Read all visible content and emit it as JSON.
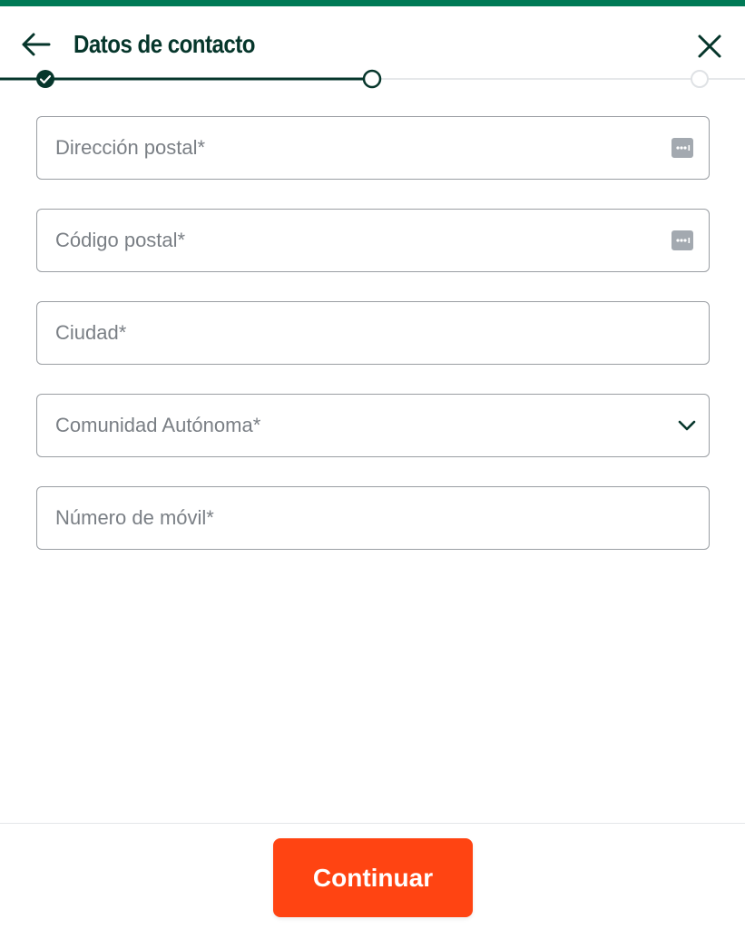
{
  "header": {
    "title": "Datos de contacto",
    "back_icon": "arrow-left-icon",
    "close_icon": "close-icon"
  },
  "stepper": {
    "total_steps": 3,
    "completed_steps": 1,
    "current_step": 2,
    "steps": [
      {
        "state": "completed",
        "icon": "check-icon"
      },
      {
        "state": "current",
        "icon": "circle-outline-icon"
      },
      {
        "state": "upcoming",
        "icon": "circle-outline-icon"
      }
    ]
  },
  "form": {
    "address": {
      "placeholder": "Dirección postal*",
      "value": "",
      "trailing_icon": "password-manager-icon"
    },
    "postal_code": {
      "placeholder": "Código postal*",
      "value": "",
      "trailing_icon": "password-manager-icon"
    },
    "city": {
      "placeholder": "Ciudad*",
      "value": ""
    },
    "region": {
      "placeholder": "Comunidad Autónoma*",
      "selected": "",
      "icon": "chevron-down-icon"
    },
    "mobile": {
      "placeholder": "Número de móvil*",
      "value": ""
    }
  },
  "footer": {
    "continue_label": "Continuar"
  },
  "colors": {
    "brand_green": "#007a56",
    "title_dark_green": "#06362b",
    "accent_orange": "#ff4412",
    "border_gray": "#9a9ea3",
    "placeholder_gray": "#7a7f85"
  }
}
